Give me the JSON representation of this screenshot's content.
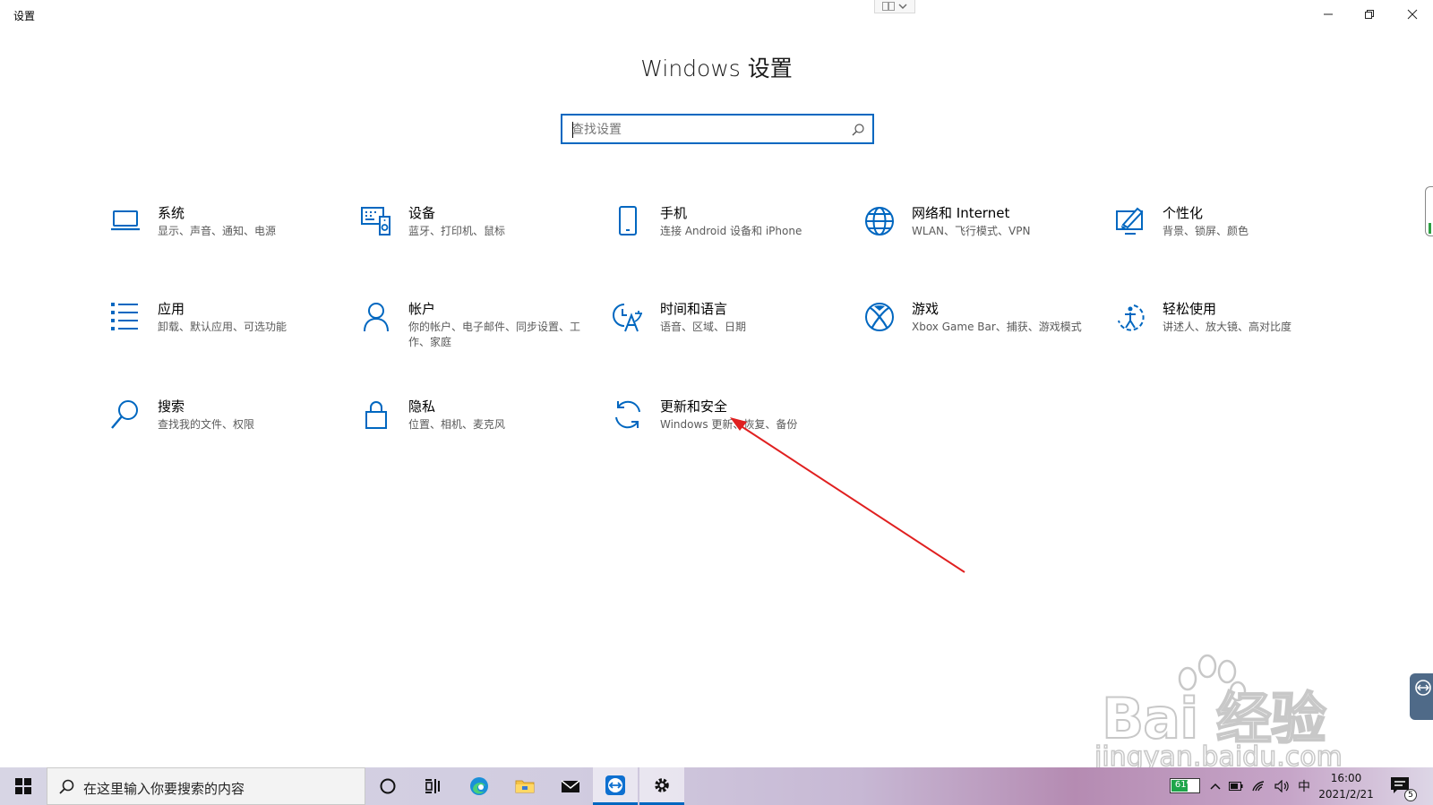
{
  "window": {
    "title": "设置",
    "controls": [
      "minimize",
      "restore",
      "close"
    ]
  },
  "header": {
    "heading": "Windows 设置",
    "search": {
      "value": "",
      "placeholder": "查找设置",
      "icon": "search-icon"
    }
  },
  "categories": [
    {
      "key": "system",
      "icon": "laptop-icon",
      "title": "系统",
      "desc": "显示、声音、通知、电源"
    },
    {
      "key": "devices",
      "icon": "keyboard-speaker-icon",
      "title": "设备",
      "desc": "蓝牙、打印机、鼠标"
    },
    {
      "key": "phone",
      "icon": "phone-icon",
      "title": "手机",
      "desc": "连接 Android 设备和 iPhone"
    },
    {
      "key": "network",
      "icon": "globe-icon",
      "title": "网络和 Internet",
      "desc": "WLAN、飞行模式、VPN"
    },
    {
      "key": "personalization",
      "icon": "paint-brush-icon",
      "title": "个性化",
      "desc": "背景、锁屏、颜色"
    },
    {
      "key": "apps",
      "icon": "app-list-icon",
      "title": "应用",
      "desc": "卸载、默认应用、可选功能"
    },
    {
      "key": "accounts",
      "icon": "person-icon",
      "title": "帐户",
      "desc": "你的帐户、电子邮件、同步设置、工作、家庭"
    },
    {
      "key": "time-language",
      "icon": "time-language-icon",
      "title": "时间和语言",
      "desc": "语音、区域、日期"
    },
    {
      "key": "gaming",
      "icon": "xbox-icon",
      "title": "游戏",
      "desc": "Xbox Game Bar、捕获、游戏模式"
    },
    {
      "key": "ease-of-access",
      "icon": "ease-of-access-icon",
      "title": "轻松使用",
      "desc": "讲述人、放大镜、高对比度"
    },
    {
      "key": "search",
      "icon": "magnifier-icon",
      "title": "搜索",
      "desc": "查找我的文件、权限"
    },
    {
      "key": "privacy",
      "icon": "lock-icon",
      "title": "隐私",
      "desc": "位置、相机、麦克风"
    },
    {
      "key": "update-security",
      "icon": "sync-icon",
      "title": "更新和安全",
      "desc": "Windows 更新、恢复、备份"
    }
  ],
  "taskbar": {
    "search_text": "在这里输入你要搜索的内容",
    "apps": [
      "cortana-icon",
      "task-view-icon",
      "edge-icon",
      "file-explorer-icon",
      "mail-icon",
      "teamviewer-icon",
      "settings-icon"
    ],
    "active_app": "settings-icon",
    "battery": "61%",
    "battery_level": 0.61,
    "ime": "中",
    "time": "16:00",
    "date": "2021/2/21",
    "notifications": "5"
  },
  "watermark": {
    "brand": "Bai 经验",
    "url": "jingyan.baidu.com"
  },
  "colors": {
    "accent": "#0067c0",
    "annotation": "#e02020"
  }
}
